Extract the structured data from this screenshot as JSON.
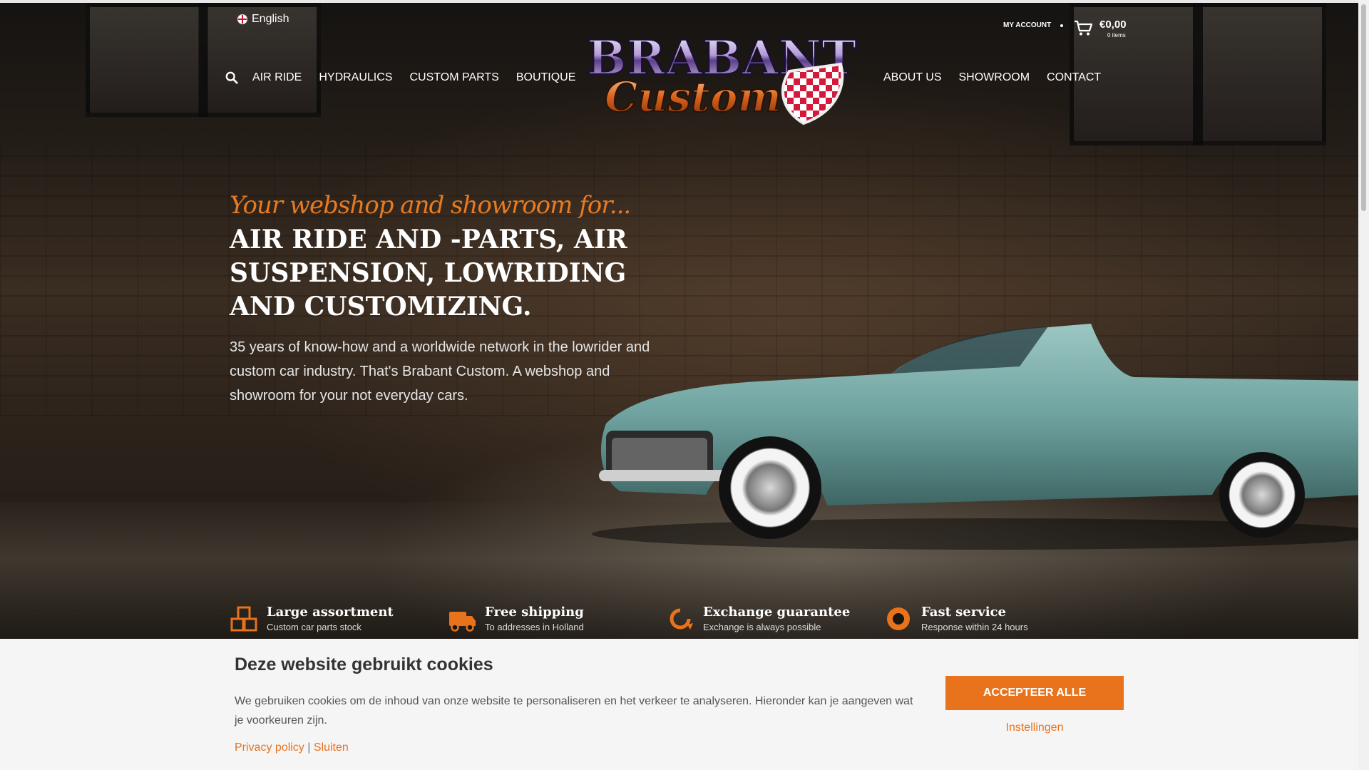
{
  "header": {
    "language": "English",
    "nav_left": [
      "AIR RIDE",
      "HYDRAULICS",
      "CUSTOM PARTS",
      "BOUTIQUE"
    ],
    "nav_right": [
      "ABOUT US",
      "SHOWROOM",
      "CONTACT"
    ],
    "logo_top": "BRABANT",
    "logo_bottom": "Custom",
    "account_label": "MY ACCOUNT",
    "cart_total": "€0,00",
    "cart_items": "0 items"
  },
  "hero": {
    "tagline": "Your webshop and showroom for...",
    "headline": "AIR RIDE AND -PARTS, AIR SUSPENSION, LOWRIDING AND CUSTOMIZING.",
    "intro": "35 years of know-how and a worldwide network in the lowrider and custom car industry. That's Brabant Custom. A webshop and showroom for your not everyday cars."
  },
  "usps": [
    {
      "title": "Large assortment",
      "subtitle": "Custom car parts stock",
      "icon": "boxes-icon"
    },
    {
      "title": "Free shipping",
      "subtitle": "To addresses in Holland",
      "icon": "truck-icon"
    },
    {
      "title": "Exchange guarantee",
      "subtitle": "Exchange is always possible",
      "icon": "exchange-icon"
    },
    {
      "title": "Fast service",
      "subtitle": "Response within 24 hours",
      "icon": "lifebuoy-icon"
    }
  ],
  "cookie": {
    "title": "Deze website gebruikt cookies",
    "text": "We gebruiken cookies om de inhoud van onze website te personaliseren en het verkeer te analyseren. Hieronder kan je aangeven wat je voorkeuren zijn.",
    "privacy": "Privacy policy",
    "separator": "|",
    "close": "Sluiten",
    "accept": "ACCEPTEER ALLE",
    "settings": "Instellingen"
  },
  "colors": {
    "accent": "#e8731c",
    "car": "#6fa3a0"
  }
}
